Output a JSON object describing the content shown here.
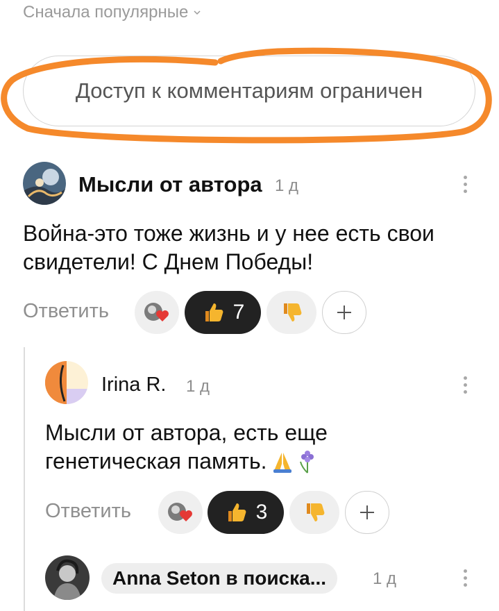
{
  "sort": {
    "label": "Сначала популярные"
  },
  "restricted": {
    "text": "Доступ к комментариям ограничен",
    "highlight_color": "#f5892b"
  },
  "comments": [
    {
      "author": "Мысли от автора",
      "time": "1 д",
      "text_lines": [
        "Война-это тоже жизнь и у нее есть свои",
        "свидетели! С Днем Победы!"
      ],
      "reply_label": "Ответить",
      "likes": "7"
    },
    {
      "author": "Irina R.",
      "time": "1 д",
      "text_lines": [
        "Мысли от автора, есть еще",
        "генетическая память."
      ],
      "reply_label": "Ответить",
      "likes": "3"
    },
    {
      "author": "Anna Seton в поиска...",
      "time": "1 д"
    }
  ],
  "colors": {
    "accent_dark": "#222222",
    "muted": "#8f8f8f",
    "thumb": "#f5a623"
  },
  "icons": [
    "chevron-down-icon",
    "kebab-menu-icon",
    "heart-icon",
    "thumbs-up-icon",
    "thumbs-down-icon",
    "plus-icon",
    "pray-icon",
    "hyacinth-icon"
  ]
}
